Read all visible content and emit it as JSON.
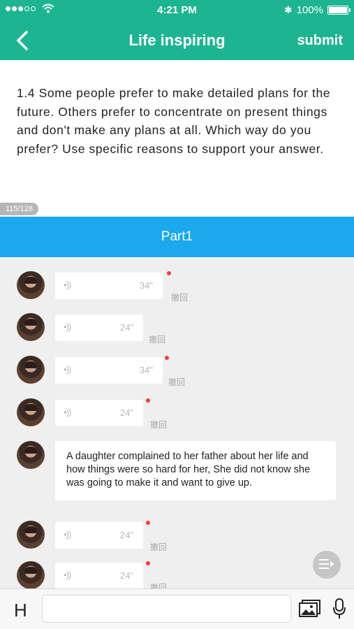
{
  "status_bar": {
    "time": "4:21 PM",
    "battery": "100%",
    "battery_level": 1.0,
    "icons": [
      "signal-icon",
      "wifi-icon",
      "bluetooth-icon",
      "battery-icon"
    ]
  },
  "nav": {
    "title": "Life inspiring",
    "submit_label": "submit",
    "back_icon": "chevron-left-icon"
  },
  "question": {
    "text": "1.4 Some people prefer to make detailed plans for the future. Others prefer to concentrate on present things and don't make any plans at all. Which way do you prefer? Use specific reasons to support your answer.",
    "counter": "115/128"
  },
  "part": {
    "label": "Part1"
  },
  "messages": [
    {
      "type": "voice",
      "duration": "34\"",
      "recall": "撤回",
      "unread": true
    },
    {
      "type": "voice",
      "duration": "24\"",
      "recall": "撤回",
      "unread": false
    },
    {
      "type": "voice",
      "duration": "34\"",
      "recall": "撤回",
      "unread": true
    },
    {
      "type": "voice",
      "duration": "24\"",
      "recall": "撤回",
      "unread": true
    },
    {
      "type": "text",
      "text": "A daughter complained to her father about her life and how things were so hard for her, She did not know she was going to make it and want to give up."
    },
    {
      "type": "voice",
      "duration": "24\"",
      "recall": "撤回",
      "unread": true
    },
    {
      "type": "voice",
      "duration": "24\"",
      "recall": "撤回",
      "unread": true
    }
  ],
  "input_bar": {
    "h_label": "H",
    "input_value": "",
    "input_placeholder": "",
    "icons": [
      "image-icon",
      "microphone-icon"
    ]
  },
  "colors": {
    "primary": "#1db591",
    "part_bar": "#1ba8ec",
    "unread_dot": "#f43c3c",
    "background": "#efefef"
  }
}
